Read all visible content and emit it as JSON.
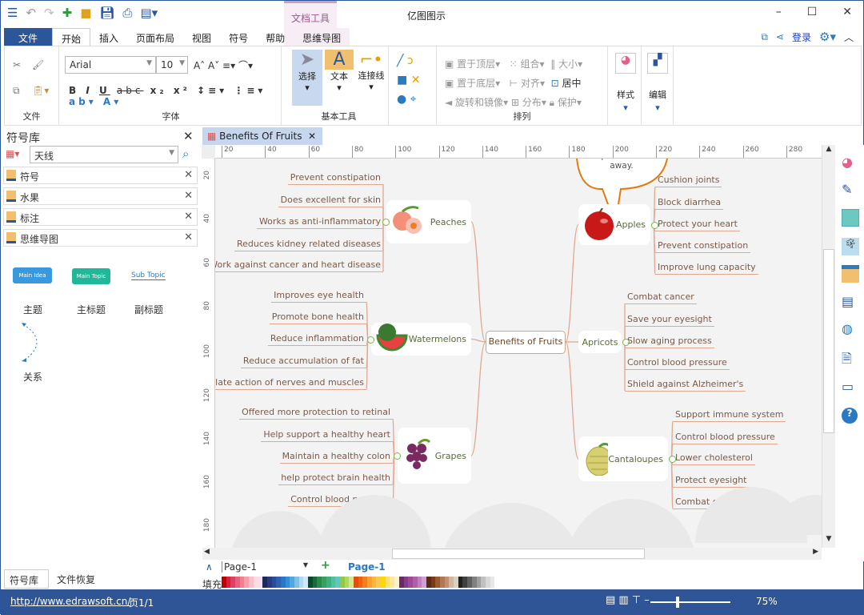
{
  "app": {
    "title": "亿图图示",
    "context_tab": "文档工具"
  },
  "menu": {
    "tabs": [
      "文件",
      "开始",
      "插入",
      "页面布局",
      "视图",
      "符号",
      "帮助",
      "思维导图"
    ],
    "login": "登录"
  },
  "ribbon": {
    "file_group": "文件",
    "font_group": "字体",
    "font_name": "Arial",
    "font_size": "10",
    "basic_group": "基本工具",
    "select": "选择",
    "text": "文本",
    "connector": "连接线",
    "arrange_group": "排列",
    "arrange": [
      "置于顶层",
      "组合",
      "大小",
      "置于底层",
      "对齐",
      "居中",
      "旋转和镜像",
      "分布",
      "保护"
    ],
    "style": "样式",
    "edit": "编辑"
  },
  "doc_tab": "Benefits Of Fruits",
  "library": {
    "title": "符号库",
    "search_value": "天线",
    "items": [
      "符号",
      "水果",
      "标注",
      "思维导图"
    ],
    "shapes": {
      "main_idea": "Main Idea",
      "main_topic": "Main Topic",
      "sub_topic": "Sub Topic",
      "labels": [
        "主题",
        "主标题",
        "副标题"
      ],
      "relation": "关系"
    },
    "bottom_tabs": [
      "符号库",
      "文件恢复"
    ]
  },
  "ruler": {
    "h": [
      "20",
      "40",
      "60",
      "80",
      "100",
      "120",
      "140",
      "160",
      "180",
      "200",
      "220",
      "240",
      "260",
      "280"
    ],
    "v": [
      "20",
      "40",
      "60",
      "80",
      "100",
      "120",
      "140",
      "160",
      "180"
    ]
  },
  "mindmap": {
    "center": "Benefits of Fruits",
    "callout": "One apple a day keeps the doctor away.",
    "branches": {
      "peaches": {
        "label": "Peaches",
        "leaves": [
          "Prevent constipation",
          "Does excellent for skin",
          "Works as anti-inflammatory",
          "Reduces kidney related diseases",
          "Work against cancer and heart disease"
        ]
      },
      "watermelons": {
        "label": "Watermelons",
        "leaves": [
          "Improves eye health",
          "Promote bone health",
          "Reduce inflammation",
          "Reduce accumulation of fat",
          "Regulate action of nerves and muscles"
        ]
      },
      "grapes": {
        "label": "Grapes",
        "leaves": [
          "Offered more protection to retinal",
          "Help support a healthy heart",
          "Maintain a healthy colon",
          "help protect brain health",
          "Control blood pressure"
        ]
      },
      "apples": {
        "label": "Apples",
        "leaves": [
          "Cushion joints",
          "Block diarrhea",
          "Protect your heart",
          "Prevent constipation",
          "Improve lung capacity"
        ]
      },
      "apricots": {
        "label": "Apricots",
        "leaves": [
          "Combat cancer",
          "Save your eyesight",
          "Slow aging process",
          "Control blood pressure",
          "Shield against Alzheimer's"
        ]
      },
      "cantaloupes": {
        "label": "Cantaloupes",
        "leaves": [
          "Support immune system",
          "Control blood pressure",
          "Lower cholesterol",
          "Protect eyesight",
          "Combat cancer"
        ]
      }
    }
  },
  "pages": {
    "current": "Page-1",
    "tab": "Page-1",
    "fill_label": "填充"
  },
  "status": {
    "url": "http://www.edrawsoft.cn/",
    "page": "页1/1",
    "zoom": "75%"
  },
  "colors": {
    "accent": "#2b579a",
    "branch_line": "#e0a890",
    "callout": "#e07a10"
  }
}
